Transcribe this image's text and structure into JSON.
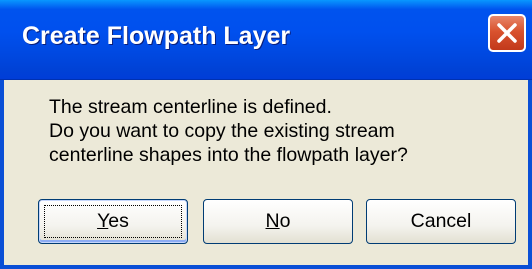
{
  "window": {
    "title": "Create Flowpath Layer"
  },
  "message": {
    "lines": [
      "The stream centerline is defined.",
      "Do you want to copy the existing stream",
      "centerline shapes into the flowpath layer?"
    ]
  },
  "buttons": {
    "yes": {
      "mnemonic": "Y",
      "rest": "es"
    },
    "no": {
      "mnemonic": "N",
      "rest": "o"
    },
    "cancel": {
      "label": "Cancel"
    }
  },
  "icons": {
    "close": "close-icon"
  },
  "colors": {
    "title_bar": "#0050ee",
    "close_button": "#d9522e",
    "dialog_background": "#ece9d8",
    "focus_border": "#003c74"
  }
}
